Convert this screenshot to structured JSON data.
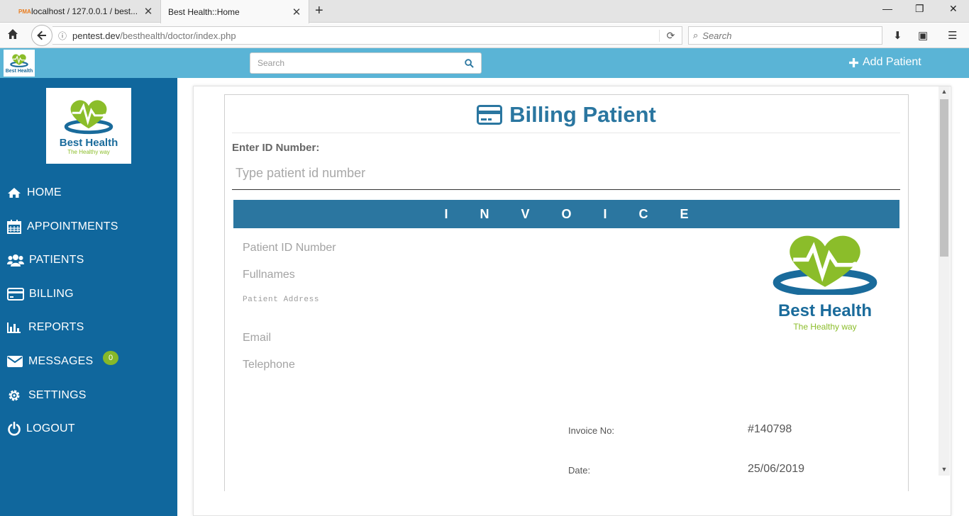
{
  "browser": {
    "tabs": [
      {
        "title": "localhost / 127.0.0.1 / best...",
        "favicon": "PMA"
      },
      {
        "title": "Best Health::Home"
      }
    ],
    "url_host": "pentest.dev",
    "url_path": "/besthealth/doctor/index.php",
    "search_placeholder": "Search"
  },
  "header": {
    "logo_text": "Best Health",
    "search_placeholder": "Search",
    "add_patient_label": "Add Patient"
  },
  "sidebar": {
    "brand": "Best Health",
    "tagline": "The Healthy way",
    "items": [
      {
        "label": "HOME",
        "icon": "home-icon"
      },
      {
        "label": "APPOINTMENTS",
        "icon": "calendar-icon"
      },
      {
        "label": "PATIENTS",
        "icon": "users-icon"
      },
      {
        "label": "BILLING",
        "icon": "credit-card-icon"
      },
      {
        "label": "REPORTS",
        "icon": "bar-chart-icon"
      },
      {
        "label": "MESSAGES",
        "icon": "envelope-icon",
        "badge": "0"
      },
      {
        "label": "SETTINGS",
        "icon": "gear-icon"
      },
      {
        "label": "LOGOUT",
        "icon": "power-icon"
      }
    ]
  },
  "billing": {
    "title": "Billing Patient",
    "id_label": "Enter ID Number:",
    "id_placeholder": "Type patient id number",
    "invoice_heading": "INVOICE",
    "fields": {
      "patient_id": "Patient ID Number",
      "fullnames": "Fullnames",
      "address": "Patient Address",
      "email": "Email",
      "telephone": "Telephone"
    },
    "logo_brand": "Best Health",
    "logo_tagline": "The Healthy way",
    "invoice_no_label": "Invoice No:",
    "invoice_no_value": "#140798",
    "date_label": "Date:",
    "date_value": "25/06/2019"
  },
  "colors": {
    "header": "#5ab4d6",
    "sidebar": "#10679d",
    "accent": "#2b76a0",
    "brand_green": "#8bbd2a"
  }
}
